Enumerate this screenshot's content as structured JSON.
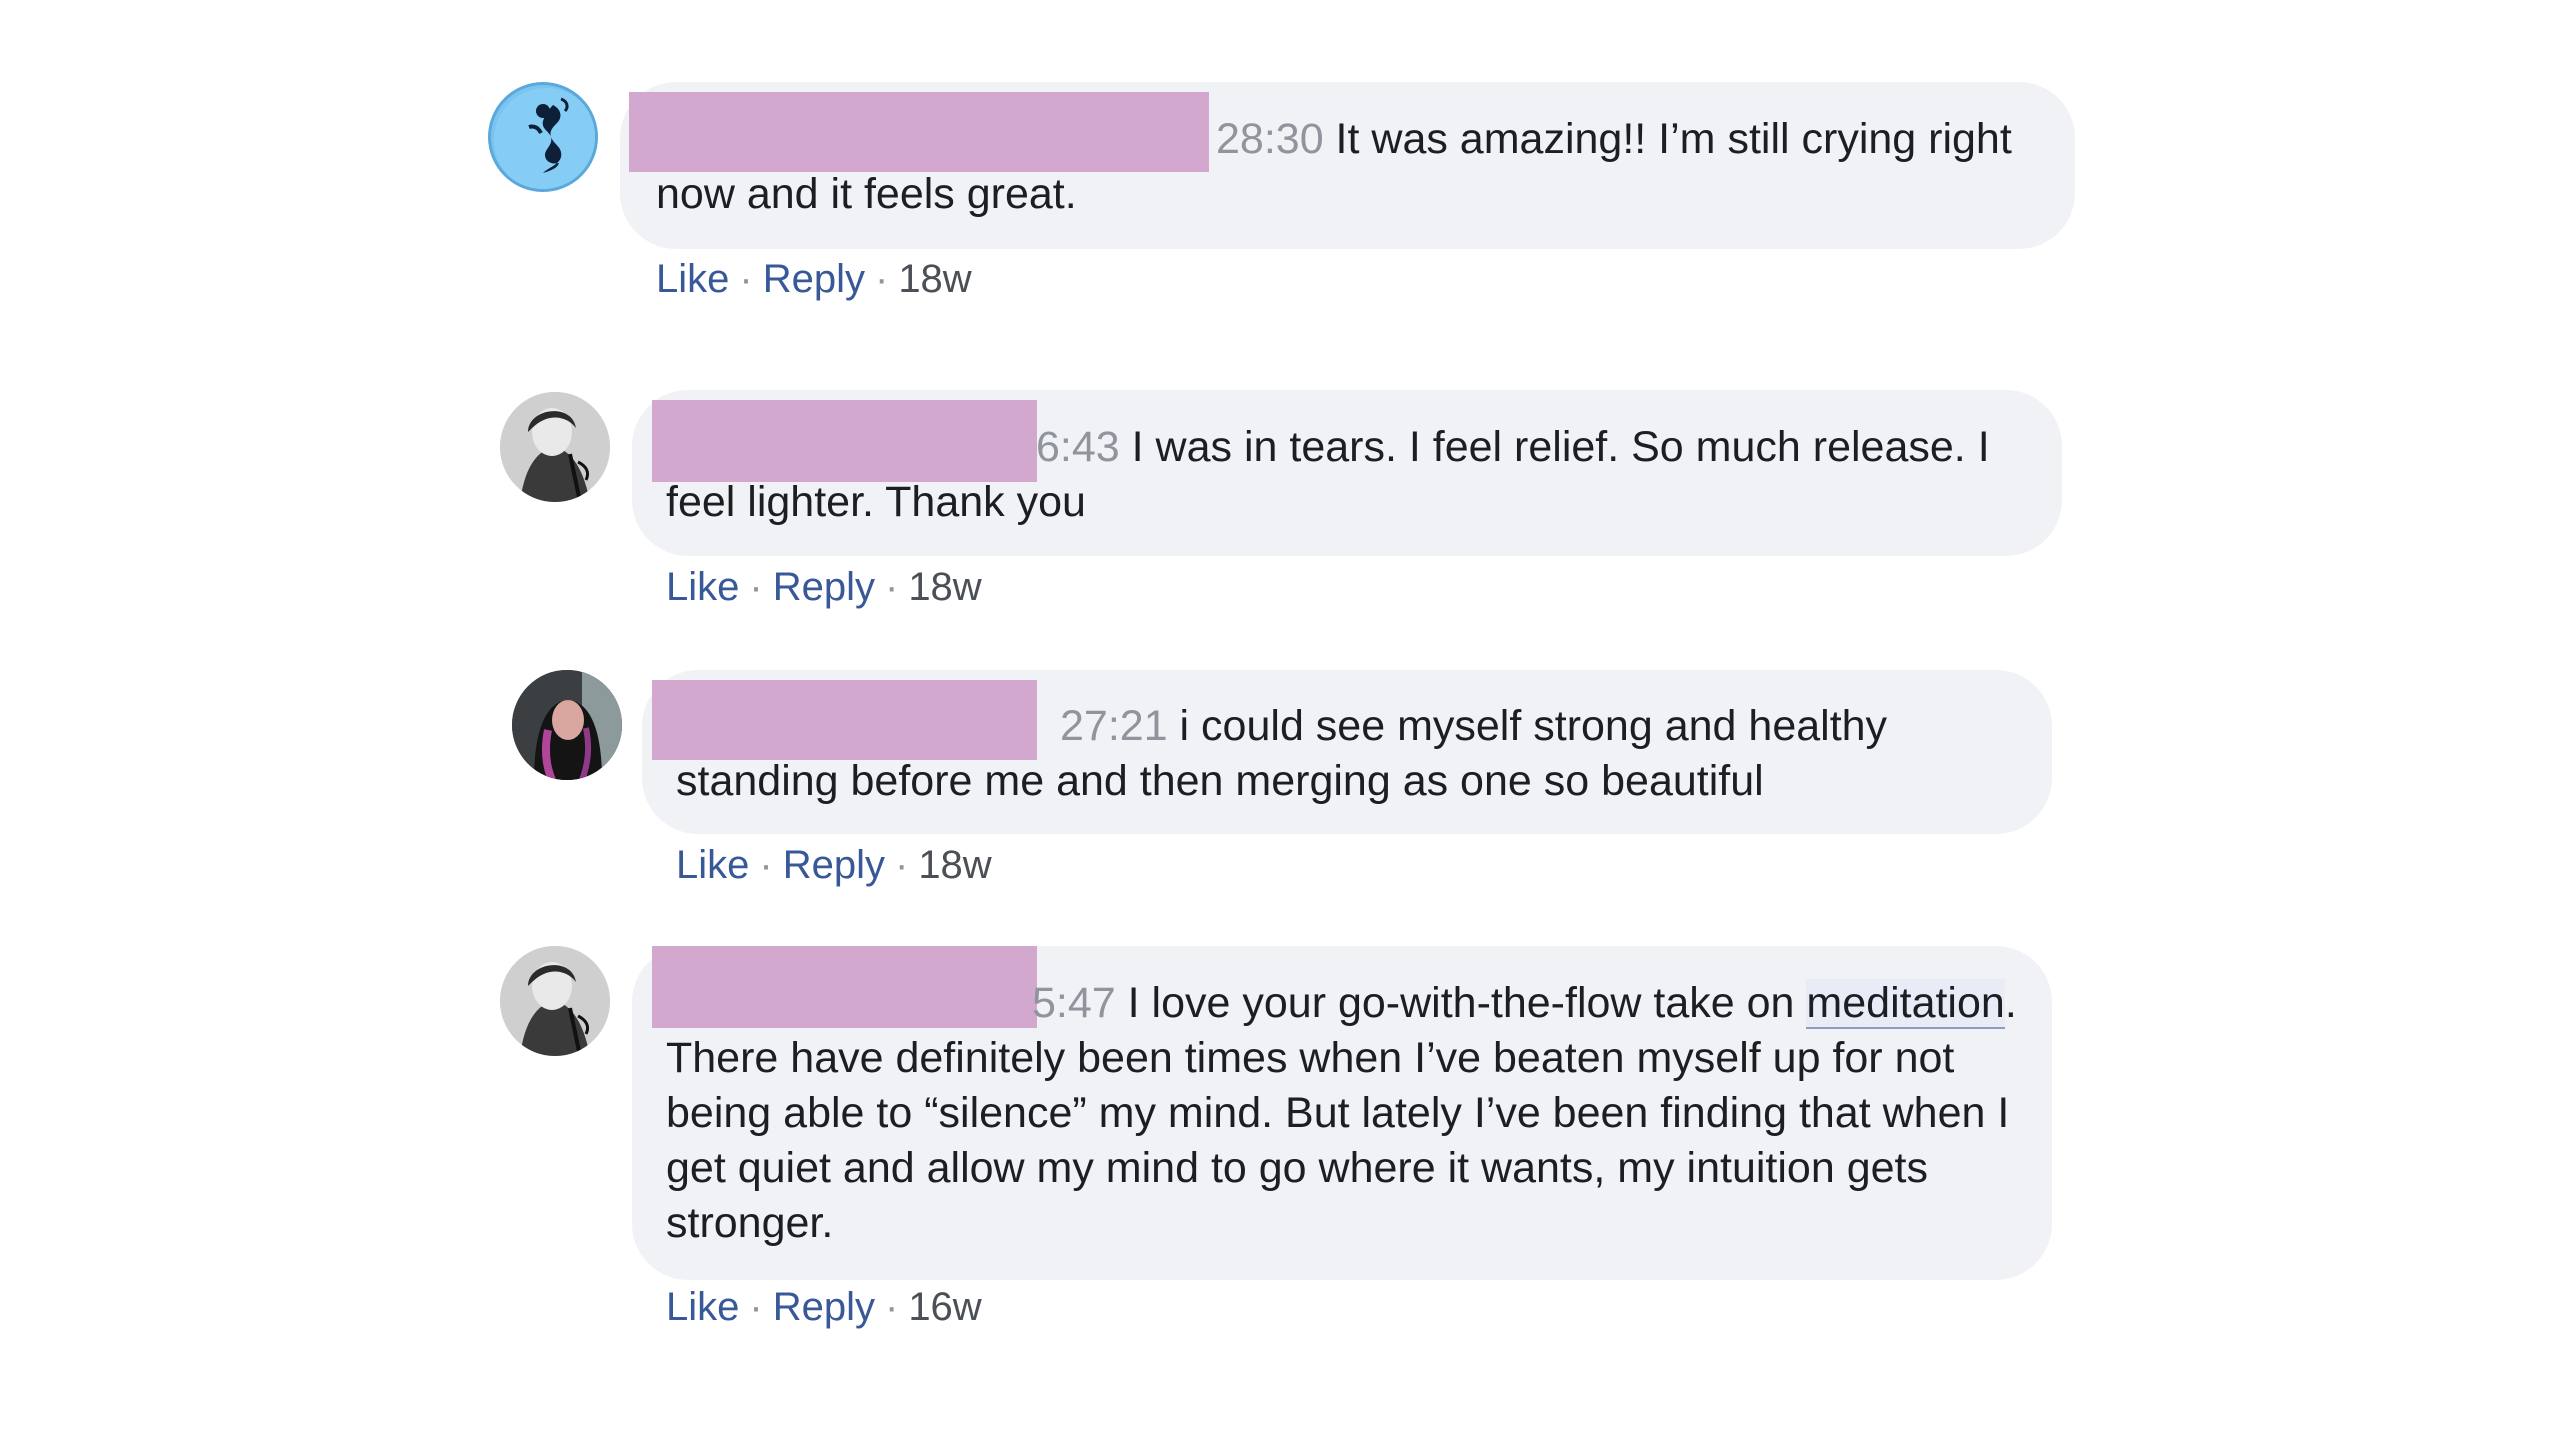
{
  "comments": [
    {
      "timestamp": "28:30",
      "text": " It was amazing!! I’m still crying right now and it feels great.",
      "like_label": "Like",
      "reply_label": "Reply",
      "sep": "·",
      "age": "18w",
      "avatar_icon": "mermaid-avatar-icon"
    },
    {
      "timestamp": "6:43",
      "text": " I was in tears. I feel relief. So much release. I feel lighter. Thank you",
      "like_label": "Like",
      "reply_label": "Reply",
      "sep": "·",
      "age": "18w",
      "avatar_icon": "profile-photo-avatar"
    },
    {
      "timestamp": "27:21",
      "text": " i could see myself strong and healthy standing before me and then merging as one so beautiful",
      "like_label": "Like",
      "reply_label": "Reply",
      "sep": "·",
      "age": "18w",
      "avatar_icon": "profile-photo-avatar"
    },
    {
      "timestamp": "5:47",
      "text_pre": " I love your go-with-the-flow take on ",
      "highlight": "meditation",
      "text": ". There have definitely been times when I’ve beaten myself up for not being able to “silence” my mind. But lately I’ve been finding that when I get quiet and allow my mind to go where it wants, my intuition gets stronger.",
      "like_label": "Like",
      "reply_label": "Reply",
      "sep": "·",
      "age": "16w",
      "avatar_icon": "profile-photo-avatar"
    }
  ],
  "colors": {
    "bubble": "#f0f2f5",
    "redaction": "#d2a8cf",
    "link": "#385898",
    "timestamp": "#90949c"
  }
}
